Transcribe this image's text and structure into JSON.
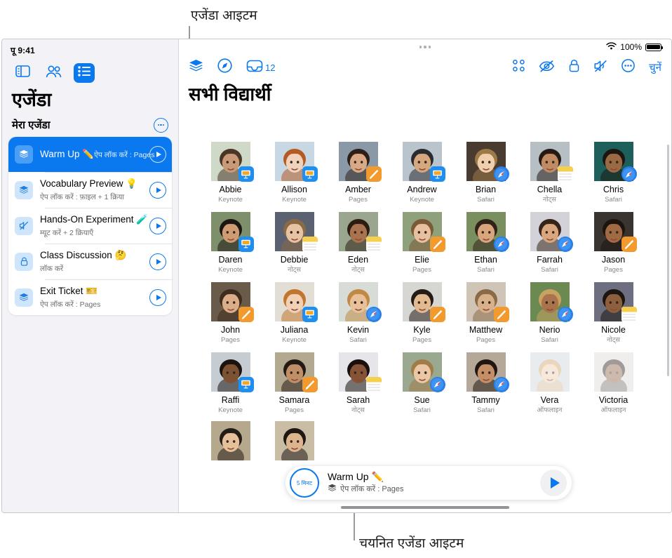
{
  "callouts": {
    "top": "एजेंडा आइटम",
    "bottom": "चयनित एजेंडा आइटम"
  },
  "sidebar": {
    "status_time": "पू 9:41",
    "toolbar_icons": [
      {
        "name": "sidebar-toggle-icon",
        "label": "साइडबार"
      },
      {
        "name": "people-icon",
        "label": "विद्यार्थी"
      },
      {
        "name": "list-icon",
        "label": "एजेंडा"
      }
    ],
    "title": "एजेंडा",
    "section_label": "मेरा एजेंडा",
    "more_label": "अधिक",
    "items": [
      {
        "title": "Warm Up ✏️",
        "subtitle": "ऐप लॉक करें : Pages",
        "icon": "layers-icon",
        "selected": true
      },
      {
        "title": "Vocabulary Preview 💡",
        "subtitle": "ऐप लॉक करें : फ़ाइल + 1 क्रिया",
        "icon": "layers-icon",
        "selected": false
      },
      {
        "title": "Hands-On Experiment 🧪",
        "subtitle": "म्यूट करें + 2 क्रियाएँ",
        "icon": "mute-icon",
        "selected": false
      },
      {
        "title": "Class Discussion 🤔",
        "subtitle": "लॉक करें",
        "icon": "lock-icon",
        "selected": false
      },
      {
        "title": "Exit Ticket 🎫",
        "subtitle": "ऐप लॉक करें : Pages",
        "icon": "layers-icon",
        "selected": false
      }
    ]
  },
  "main": {
    "status": {
      "battery_percent": "100%",
      "wifi": "wifi-icon"
    },
    "toolbar_left": [
      {
        "name": "layers-icon",
        "label": "लेयर",
        "badge": ""
      },
      {
        "name": "navigate-icon",
        "label": "नेविगेट",
        "badge": ""
      },
      {
        "name": "inbox-icon",
        "label": "इनबॉक्स",
        "badge": "12"
      }
    ],
    "toolbar_right": [
      {
        "name": "grid-icon",
        "label": "ग्रिड"
      },
      {
        "name": "eye-slash-icon",
        "label": "स्क्रीन छिपाएँ"
      },
      {
        "name": "lock-icon",
        "label": "लॉक"
      },
      {
        "name": "speaker-slash-icon",
        "label": "म्यूट"
      },
      {
        "name": "ellipsis-icon",
        "label": "और"
      }
    ],
    "select_label": "चुनें",
    "page_title": "सभी विद्यार्थी",
    "students": [
      [
        {
          "name": "Abbie",
          "app": "Keynote",
          "badge": "keynote",
          "offline": false,
          "skin": "#c89a78",
          "hair": "#4a3526",
          "bg": "#cfd9c8"
        },
        {
          "name": "Allison",
          "app": "Keynote",
          "badge": "keynote",
          "offline": false,
          "skin": "#f0d2bd",
          "hair": "#b55a23",
          "bg": "#c7d8e4"
        },
        {
          "name": "Amber",
          "app": "Pages",
          "badge": "pages",
          "offline": false,
          "skin": "#d9a985",
          "hair": "#2e2018",
          "bg": "#8a99a8"
        },
        {
          "name": "Andrew",
          "app": "Keynote",
          "badge": "keynote",
          "offline": false,
          "skin": "#d6a87e",
          "hair": "#2c2c30",
          "bg": "#b9c4cc"
        },
        {
          "name": "Brian",
          "app": "Safari",
          "badge": "safari",
          "offline": false,
          "skin": "#efcfae",
          "hair": "#9c7a46",
          "bg": "#4a3b30"
        },
        {
          "name": "Chella",
          "app": "नोट्स",
          "badge": "notes",
          "offline": false,
          "skin": "#c08a63",
          "hair": "#241a14",
          "bg": "#b6bfc4"
        },
        {
          "name": "Chris",
          "app": "Safari",
          "badge": "safari",
          "offline": false,
          "skin": "#9b6a45",
          "hair": "#1d1510",
          "bg": "#1d5f5a"
        }
      ],
      [
        {
          "name": "Daren",
          "app": "Keynote",
          "badge": "keynote",
          "offline": false,
          "skin": "#cf9b72",
          "hair": "#1b1612",
          "bg": "#7d8f6b"
        },
        {
          "name": "Debbie",
          "app": "नोट्स",
          "badge": "notes",
          "offline": false,
          "skin": "#e7c3a4",
          "hair": "#8a6a44",
          "bg": "#5a6170"
        },
        {
          "name": "Eden",
          "app": "नोट्स",
          "badge": "notes",
          "offline": false,
          "skin": "#a9744d",
          "hair": "#2b1d14",
          "bg": "#9aa68d"
        },
        {
          "name": "Elie",
          "app": "Pages",
          "badge": "pages",
          "offline": false,
          "skin": "#e8c0a0",
          "hair": "#7b5a36",
          "bg": "#8fa07c"
        },
        {
          "name": "Ethan",
          "app": "Safari",
          "badge": "safari",
          "offline": false,
          "skin": "#d8a57c",
          "hair": "#32231a",
          "bg": "#798f5e"
        },
        {
          "name": "Farrah",
          "app": "Safari",
          "badge": "safari",
          "offline": false,
          "skin": "#d9a67e",
          "hair": "#36241a",
          "bg": "#d2d2d8"
        },
        {
          "name": "Jason",
          "app": "Pages",
          "badge": "pages",
          "offline": false,
          "skin": "#a06b44",
          "hair": "#1d140e",
          "bg": "#3a3430"
        }
      ],
      [
        {
          "name": "John",
          "app": "Pages",
          "badge": "pages",
          "offline": false,
          "skin": "#dbae87",
          "hair": "#3e2c1e",
          "bg": "#6a5a4a"
        },
        {
          "name": "Juliana",
          "app": "Keynote",
          "badge": "keynote",
          "offline": false,
          "skin": "#f1d0b5",
          "hair": "#c0762e",
          "bg": "#e2ded6"
        },
        {
          "name": "Kevin",
          "app": "Safari",
          "badge": "safari",
          "offline": false,
          "skin": "#e9c199",
          "hair": "#c08a46",
          "bg": "#d8dcd6"
        },
        {
          "name": "Kyle",
          "app": "Pages",
          "badge": "pages",
          "offline": false,
          "skin": "#e3b98f",
          "hair": "#241c16",
          "bg": "#d6d6d2"
        },
        {
          "name": "Matthew",
          "app": "Pages",
          "badge": "pages",
          "offline": false,
          "skin": "#d8b08a",
          "hair": "#8a6b48",
          "bg": "#cfc4b6"
        },
        {
          "name": "Nerio",
          "app": "Safari",
          "badge": "safari",
          "offline": false,
          "skin": "#a9744c",
          "hair": "#c8a263",
          "bg": "#6a8a52"
        },
        {
          "name": "Nicole",
          "app": "नोट्स",
          "badge": "notes",
          "offline": false,
          "skin": "#8e5f3c",
          "hair": "#1d1510",
          "bg": "#6d6f80"
        }
      ],
      [
        {
          "name": "Raffi",
          "app": "Keynote",
          "badge": "keynote",
          "offline": false,
          "skin": "#7d5232",
          "hair": "#1a1310",
          "bg": "#c5ccd2"
        },
        {
          "name": "Samara",
          "app": "Pages",
          "badge": "pages",
          "offline": false,
          "skin": "#c08f68",
          "hair": "#241a13",
          "bg": "#b3a890"
        },
        {
          "name": "Sarah",
          "app": "नोट्स",
          "badge": "notes",
          "offline": false,
          "skin": "#875336",
          "hair": "#17100c",
          "bg": "#e6e6ea"
        },
        {
          "name": "Sue",
          "app": "Safari",
          "badge": "safari",
          "offline": false,
          "skin": "#ecc7a6",
          "hair": "#a07c48",
          "bg": "#9aa890"
        },
        {
          "name": "Tammy",
          "app": "Safari",
          "badge": "safari",
          "offline": false,
          "skin": "#c48f66",
          "hair": "#201713",
          "bg": "#b5a898"
        },
        {
          "name": "Vera",
          "app": "ऑफलाइन",
          "badge": "none",
          "offline": true,
          "skin": "#eccba9",
          "hair": "#cfa063",
          "bg": "#cdd4d8"
        },
        {
          "name": "Victoria",
          "app": "ऑफलाइन",
          "badge": "none",
          "offline": true,
          "skin": "#8d5c3b",
          "hair": "#1c1410",
          "bg": "#ddd9d4"
        }
      ],
      [
        {
          "name": "",
          "app": "",
          "badge": "none",
          "offline": false,
          "skin": "#e5c09a",
          "hair": "#241c16",
          "bg": "#b6a88c"
        },
        {
          "name": "",
          "app": "",
          "badge": "none",
          "offline": false,
          "skin": "#dcb48e",
          "hair": "#1e1712",
          "bg": "#c9bda6"
        }
      ]
    ]
  },
  "nowbar": {
    "timer": "5 मिनट",
    "title": "Warm Up ✏️",
    "subtitle": "ऐप लॉक करें : Pages",
    "play_label": "चलाएँ"
  },
  "colors": {
    "accent": "#0a78ef",
    "sidebar_bg": "#f2f2f7",
    "selected_row": "#0a78ef",
    "muted_text": "#8a8a8e"
  }
}
